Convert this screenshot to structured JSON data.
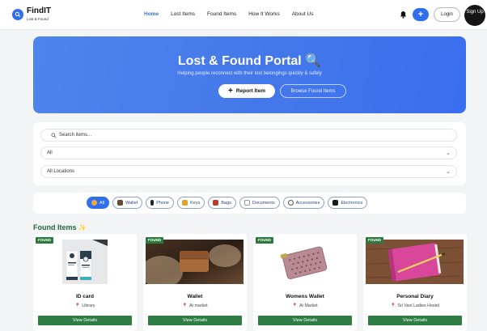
{
  "brand": {
    "name": "FindIT",
    "tagline": "Lost & Found"
  },
  "nav": {
    "links": [
      {
        "label": "Home"
      },
      {
        "label": "Lost Items"
      },
      {
        "label": "Found Items"
      },
      {
        "label": "How It Works"
      },
      {
        "label": "About Us"
      }
    ],
    "active": "Home",
    "plus_label": "+",
    "login_label": "Login",
    "signup_label": "Sign Up"
  },
  "hero": {
    "title": "Lost & Found Portal 🔍",
    "subtitle": "Helping people reconnect with their lost belongings quickly & safely",
    "report_label": "Report Item",
    "report_icon": "+",
    "browse_label": "Browse Found Items"
  },
  "filters": {
    "search_placeholder": "Search items...",
    "category_value": "All",
    "location_value": "All Locations"
  },
  "categories": [
    {
      "label": "All",
      "icon": "grid-icon",
      "active": true
    },
    {
      "label": "Wallet",
      "icon": "wallet-icon"
    },
    {
      "label": "Phone",
      "icon": "phone-icon"
    },
    {
      "label": "Keys",
      "icon": "key-icon"
    },
    {
      "label": "Bags",
      "icon": "bag-icon"
    },
    {
      "label": "Documents",
      "icon": "document-icon"
    },
    {
      "label": "Accessories",
      "icon": "headphones-icon"
    },
    {
      "label": "Electronics",
      "icon": "monitor-icon"
    }
  ],
  "found_section": {
    "title": "Found Items",
    "sparkle": "✨"
  },
  "found_items": [
    {
      "badge": "FOUND",
      "name": "ID card",
      "location": "Library",
      "action": "View Details"
    },
    {
      "badge": "FOUND",
      "name": "Wallet",
      "location": "At market",
      "action": "View Details"
    },
    {
      "badge": "FOUND",
      "name": "Womens Wallet",
      "location": "At Market",
      "action": "View Details"
    },
    {
      "badge": "FOUND",
      "name": "Personal Diary",
      "location": "Sri Vani Ladies Hostel",
      "action": "View Details"
    }
  ],
  "colors": {
    "primary": "#2f6fed",
    "found_green": "#2c7a3f",
    "hero_start": "#4f84ec",
    "hero_end": "#3a6ef0"
  }
}
